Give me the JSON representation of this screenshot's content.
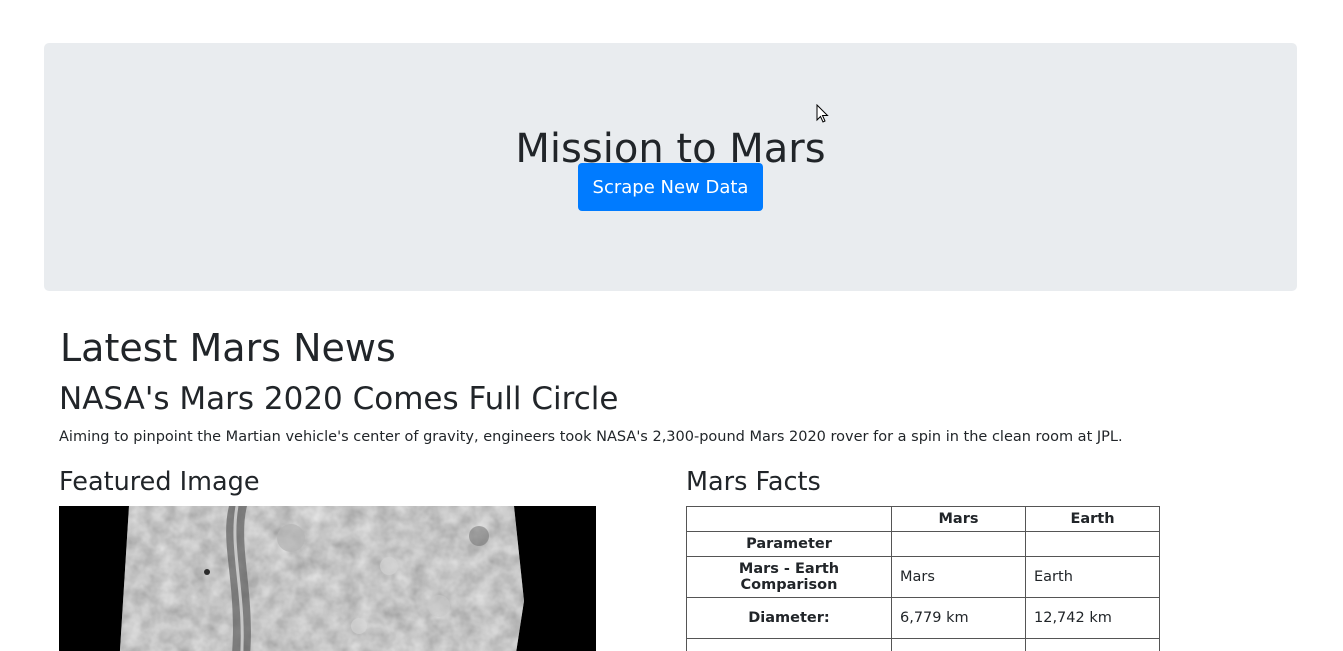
{
  "jumbotron": {
    "title": "Mission to Mars",
    "scrape_button_label": "Scrape New Data"
  },
  "news": {
    "section_title": "Latest Mars News",
    "article_title": "NASA's Mars 2020 Comes Full Circle",
    "article_teaser": "Aiming to pinpoint the Martian vehicle's center of gravity, engineers took NASA's 2,300-pound Mars 2020 rover for a spin in the clean room at JPL."
  },
  "featured": {
    "section_title": "Featured Image"
  },
  "facts": {
    "section_title": "Mars Facts",
    "header_columns": [
      "",
      "Mars",
      "Earth"
    ],
    "index_label": "Parameter",
    "rows": [
      {
        "param": "Mars - Earth Comparison",
        "mars": "Mars",
        "earth": "Earth"
      },
      {
        "param": "Diameter:",
        "mars": "6,779 km",
        "earth": "12,742 km"
      },
      {
        "param": "",
        "mars": "",
        "earth": ""
      }
    ]
  },
  "colors": {
    "jumbotron_bg": "#e9ecef",
    "primary_button": "#007bff"
  }
}
